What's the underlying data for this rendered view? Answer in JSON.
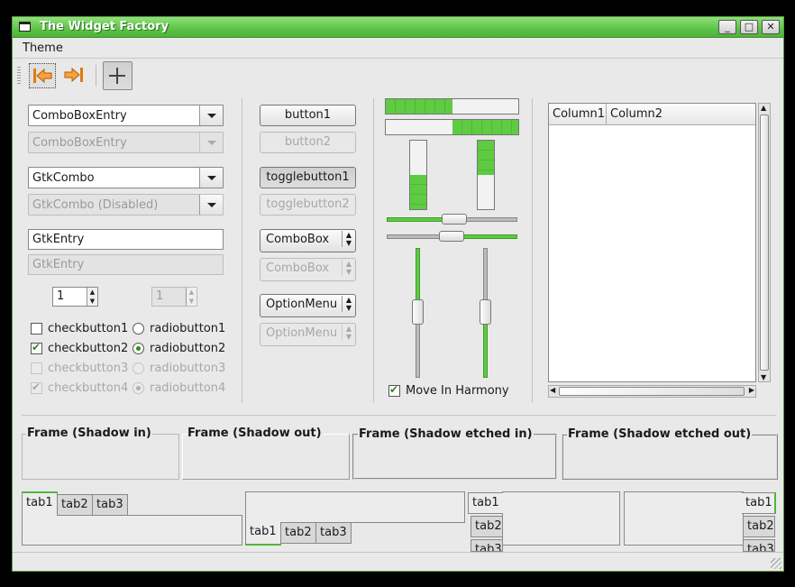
{
  "window": {
    "title": "The Widget Factory"
  },
  "menubar": {
    "theme": "Theme"
  },
  "toolbar": {
    "back_icon": "arrow-left-icon",
    "forward_icon": "arrow-right-icon",
    "add_icon": "plus-icon"
  },
  "colors": {
    "accent": "#5ecb43",
    "titlebar": "#5cc346"
  },
  "col1": {
    "combo_entry": "ComboBoxEntry",
    "combo_entry_dis": "ComboBoxEntry",
    "gtkcombo": "GtkCombo",
    "gtkcombo_dis": "GtkCombo (Disabled)",
    "entry": "GtkEntry",
    "entry_dis": "GtkEntry",
    "spin": "1",
    "spin_dis": "1",
    "checks": [
      {
        "label": "checkbutton1",
        "checked": false
      },
      {
        "label": "checkbutton2",
        "checked": true
      },
      {
        "label": "checkbutton3",
        "checked": false
      },
      {
        "label": "checkbutton4",
        "checked": true
      }
    ],
    "radios": [
      {
        "label": "radiobutton1",
        "checked": false
      },
      {
        "label": "radiobutton2",
        "checked": true
      },
      {
        "label": "radiobutton3",
        "checked": false
      },
      {
        "label": "radiobutton4",
        "checked": true
      }
    ]
  },
  "col2": {
    "button1": "button1",
    "button2": "button2",
    "toggle1": "togglebutton1",
    "toggle2": "togglebutton2",
    "combobox": "ComboBox",
    "combobox_dis": "ComboBox",
    "optionmenu": "OptionMenu",
    "optionmenu_dis": "OptionMenu"
  },
  "col3": {
    "progress_h1": 0.5,
    "progress_h2": 0.5,
    "progress_v1": 0.5,
    "progress_v2": 0.5,
    "harmony": "Move In Harmony"
  },
  "tree": {
    "columns": [
      "Column1",
      "Column2"
    ]
  },
  "frames": {
    "shadow_in": "Frame (Shadow in)",
    "shadow_out": "Frame (Shadow out)",
    "etched_in": "Frame (Shadow etched in)",
    "etched_out": "Frame (Shadow etched out)"
  },
  "notebooks": {
    "tabs": [
      "tab1",
      "tab2",
      "tab3"
    ]
  }
}
